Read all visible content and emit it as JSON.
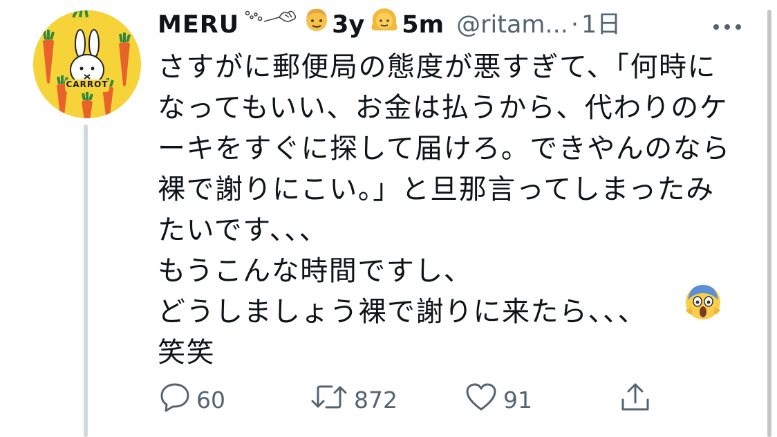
{
  "tweet": {
    "display_name": "MERU",
    "age_label_1": "3y",
    "age_label_2": "5m",
    "handle": "@ritam...",
    "separator": "·",
    "time": "1日",
    "decor_icon": "sparkle-bouquet-icon",
    "emoji_1": "boy-face-emoji",
    "emoji_2": "girl-face-emoji",
    "avatar": {
      "text": "CARROT",
      "icon": "rabbit-with-carrots-avatar",
      "bg_color": "#f7d33a",
      "carrot_color": "#e8622c",
      "leaf_color": "#2e8b3e"
    },
    "lines": [
      "さすがに郵便局の態度が悪すぎて、「何時に",
      "なってもいい、お金は払うから、代わりのケ",
      "ーキをすぐに探して届けろ。できやんのなら",
      "裸で謝りにこい。」と旦那言ってしまったみ",
      "たいです、、、",
      "もうこんな時間ですし、",
      "どうしましょう裸で謝りに来たら、、、",
      "笑笑"
    ],
    "end_emoji": "face-screaming-in-fear-emoji"
  },
  "actions": {
    "reply": {
      "icon": "reply-bubble-icon",
      "count": "60"
    },
    "retweet": {
      "icon": "retweet-icon",
      "count": "872"
    },
    "like": {
      "icon": "heart-icon",
      "count": "91"
    },
    "share": {
      "icon": "share-upload-icon"
    }
  },
  "colors": {
    "text": "#0f1419",
    "secondary": "#536471",
    "thread_line": "#cfd9de"
  }
}
